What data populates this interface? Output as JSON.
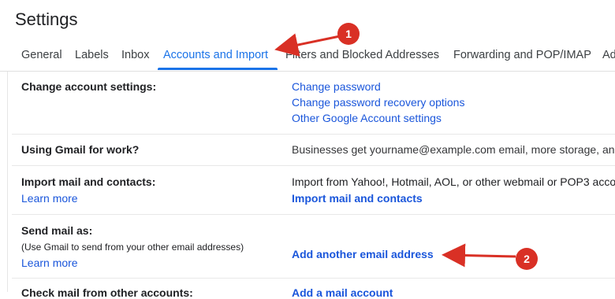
{
  "page": {
    "title": "Settings"
  },
  "tabs": [
    {
      "label": "General"
    },
    {
      "label": "Labels"
    },
    {
      "label": "Inbox"
    },
    {
      "label": "Accounts and Import",
      "active": true
    },
    {
      "label": "Filters and Blocked Addresses"
    },
    {
      "label": "Forwarding and POP/IMAP"
    },
    {
      "label": "Ad"
    }
  ],
  "sections": {
    "change_account": {
      "label": "Change account settings:",
      "links": [
        "Change password",
        "Change password recovery options",
        "Other Google Account settings"
      ]
    },
    "gmail_work": {
      "label": "Using Gmail for work?",
      "text": "Businesses get yourname@example.com email, more storage, an"
    },
    "import_mail": {
      "label": "Import mail and contacts:",
      "learn_more": "Learn more",
      "text": "Import from Yahoo!, Hotmail, AOL, or other webmail or POP3 acco",
      "action": "Import mail and contacts"
    },
    "send_mail": {
      "label": "Send mail as:",
      "sublabel": "(Use Gmail to send from your other email addresses)",
      "learn_more": "Learn more",
      "action": "Add another email address"
    },
    "check_mail": {
      "label": "Check mail from other accounts:",
      "action": "Add a mail account"
    }
  },
  "annotations": {
    "badges": [
      "1",
      "2"
    ],
    "color": "#d93025"
  },
  "colors": {
    "accent": "#1a73e8",
    "link": "#1a56db",
    "annotation": "#d93025"
  }
}
